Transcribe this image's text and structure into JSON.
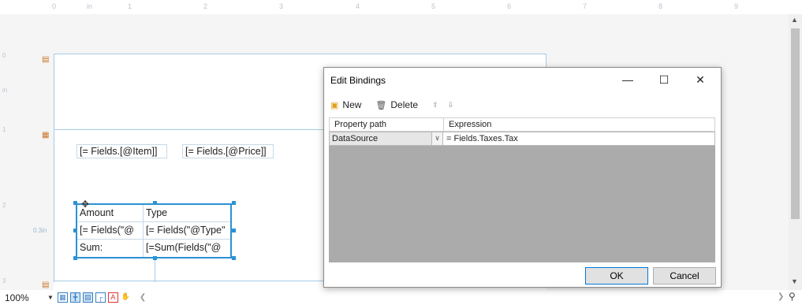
{
  "ruler": {
    "top_ticks": [
      "0",
      "in",
      "1",
      "2",
      "3",
      "4",
      "5",
      "6",
      "7",
      "8",
      "9"
    ],
    "left_ticks": [
      "0",
      "in",
      "1",
      "2",
      "3"
    ]
  },
  "design": {
    "fields": {
      "item": "[= Fields.[@Item]]",
      "price": "[= Fields.[@Price]]"
    },
    "table": {
      "rows": [
        [
          "Amount",
          "Type"
        ],
        [
          "[= Fields(\"@",
          "[= Fields(\"@Type\""
        ],
        [
          "Sum:",
          "[=Sum(Fields(\"@"
        ]
      ]
    },
    "side_label": "0.3in"
  },
  "statusbar": {
    "zoom": "100%"
  },
  "dialog": {
    "title": "Edit Bindings",
    "toolbar": {
      "new_label": "New",
      "delete_label": "Delete"
    },
    "grid": {
      "headers": [
        "Property path",
        "Expression"
      ],
      "rows": [
        {
          "property": "DataSource",
          "expression": "= Fields.Taxes.Tax"
        }
      ]
    },
    "ok_label": "OK",
    "cancel_label": "Cancel"
  }
}
